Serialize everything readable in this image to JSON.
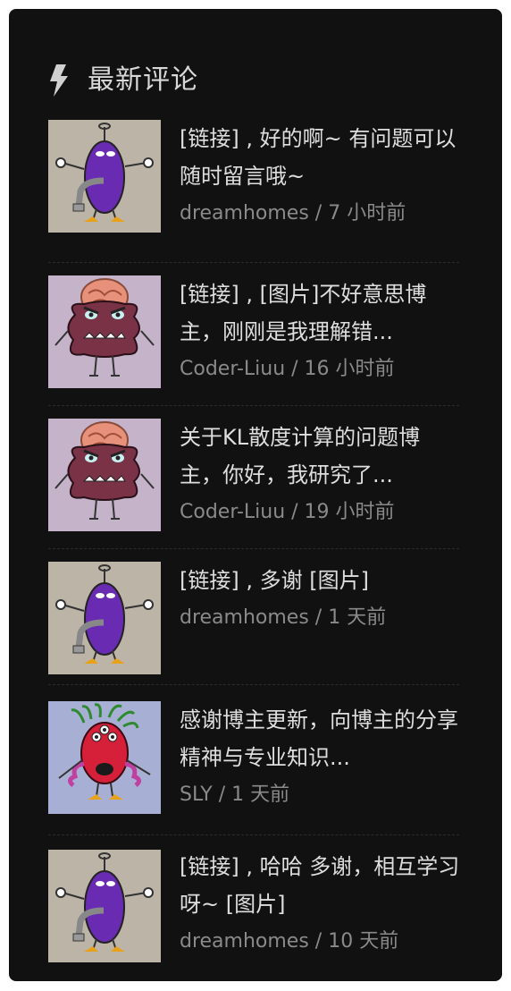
{
  "widget": {
    "title": "最新评论",
    "icon": "bolt-icon"
  },
  "comments": [
    {
      "text": "[链接] , 好的啊~ 有问题可以随时留言哦~",
      "meta": "dreamhomes / 7 小时前",
      "avatar": "purple-monster-avatar"
    },
    {
      "text": "[链接] , [图片]不好意思博主，刚刚是我理解错...",
      "meta": "Coder-Liuu / 16 小时前",
      "avatar": "brain-monster-avatar"
    },
    {
      "text": "关于KL散度计算的问题博主，你好，我研究了...",
      "meta": "Coder-Liuu / 19 小时前",
      "avatar": "brain-monster-avatar"
    },
    {
      "text": "[链接] , 多谢 [图片]",
      "meta": "dreamhomes / 1 天前",
      "avatar": "purple-monster-avatar"
    },
    {
      "text": "感谢博主更新，向博主的分享精神与专业知识...",
      "meta": "SLY / 1 天前",
      "avatar": "red-monster-avatar"
    },
    {
      "text": "[链接] , 哈哈 多谢，相互学习呀~ [图片]",
      "meta": "dreamhomes / 10 天前",
      "avatar": "purple-monster-avatar"
    }
  ],
  "colors": {
    "panel_bg": "#111111",
    "text": "#dedede",
    "meta": "#8a8a8a"
  }
}
